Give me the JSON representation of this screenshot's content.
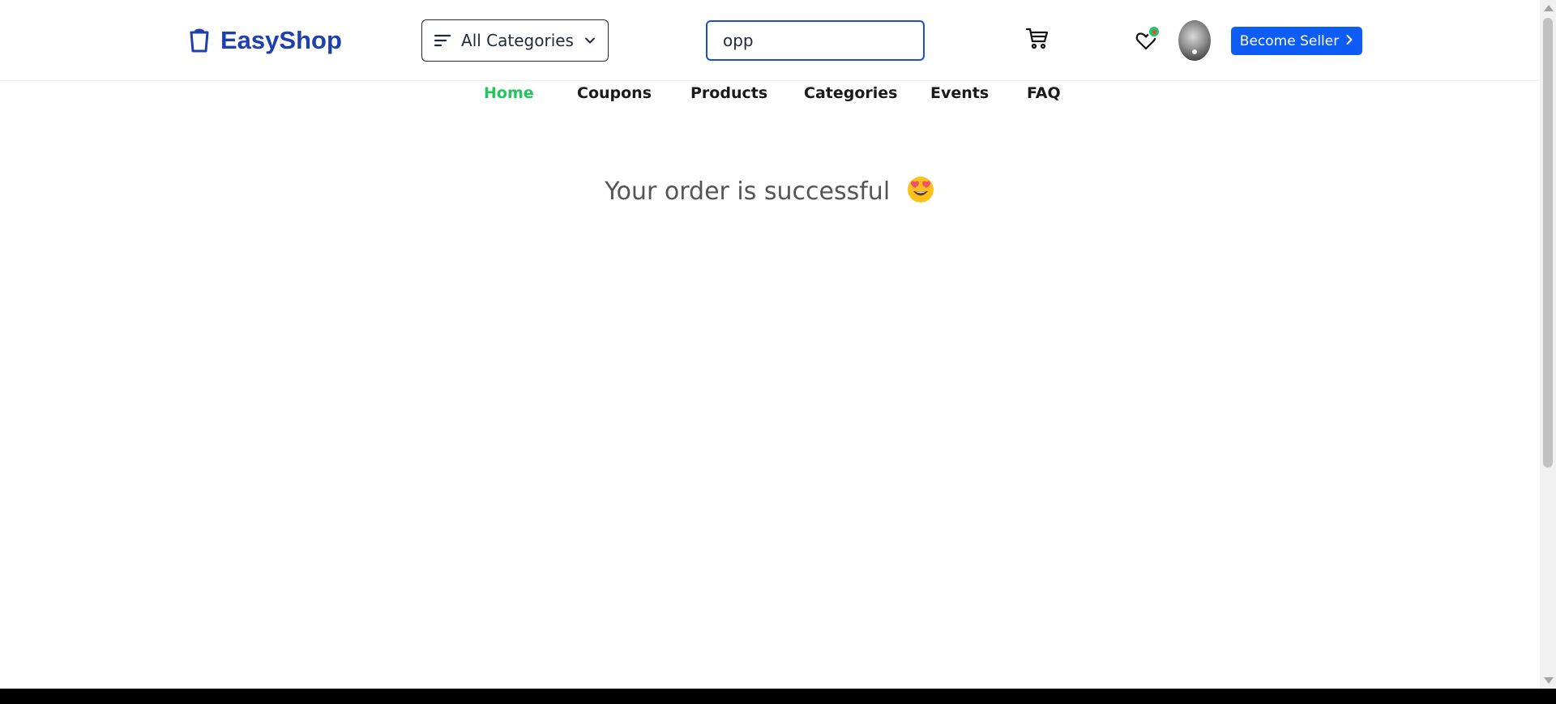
{
  "header": {
    "logo_text": "EasyShop",
    "category_label": "All Categories",
    "search_value": "opp",
    "seller_label": "Become Seller"
  },
  "nav": {
    "items": [
      "Home",
      "Coupons",
      "Products",
      "Categories",
      "Events",
      "FAQ"
    ],
    "active": "Home"
  },
  "main": {
    "message": "Your order is successful"
  },
  "colors": {
    "brand": "#1e40af",
    "accent": "#0d5cf5",
    "nav_active": "#22c55e"
  },
  "icons": [
    "shopping-bag-icon",
    "filter-lines-icon",
    "chevron-down-icon",
    "cart-icon",
    "heart-icon",
    "chevron-right-icon",
    "smiling-face-with-heart-eyes-icon"
  ]
}
